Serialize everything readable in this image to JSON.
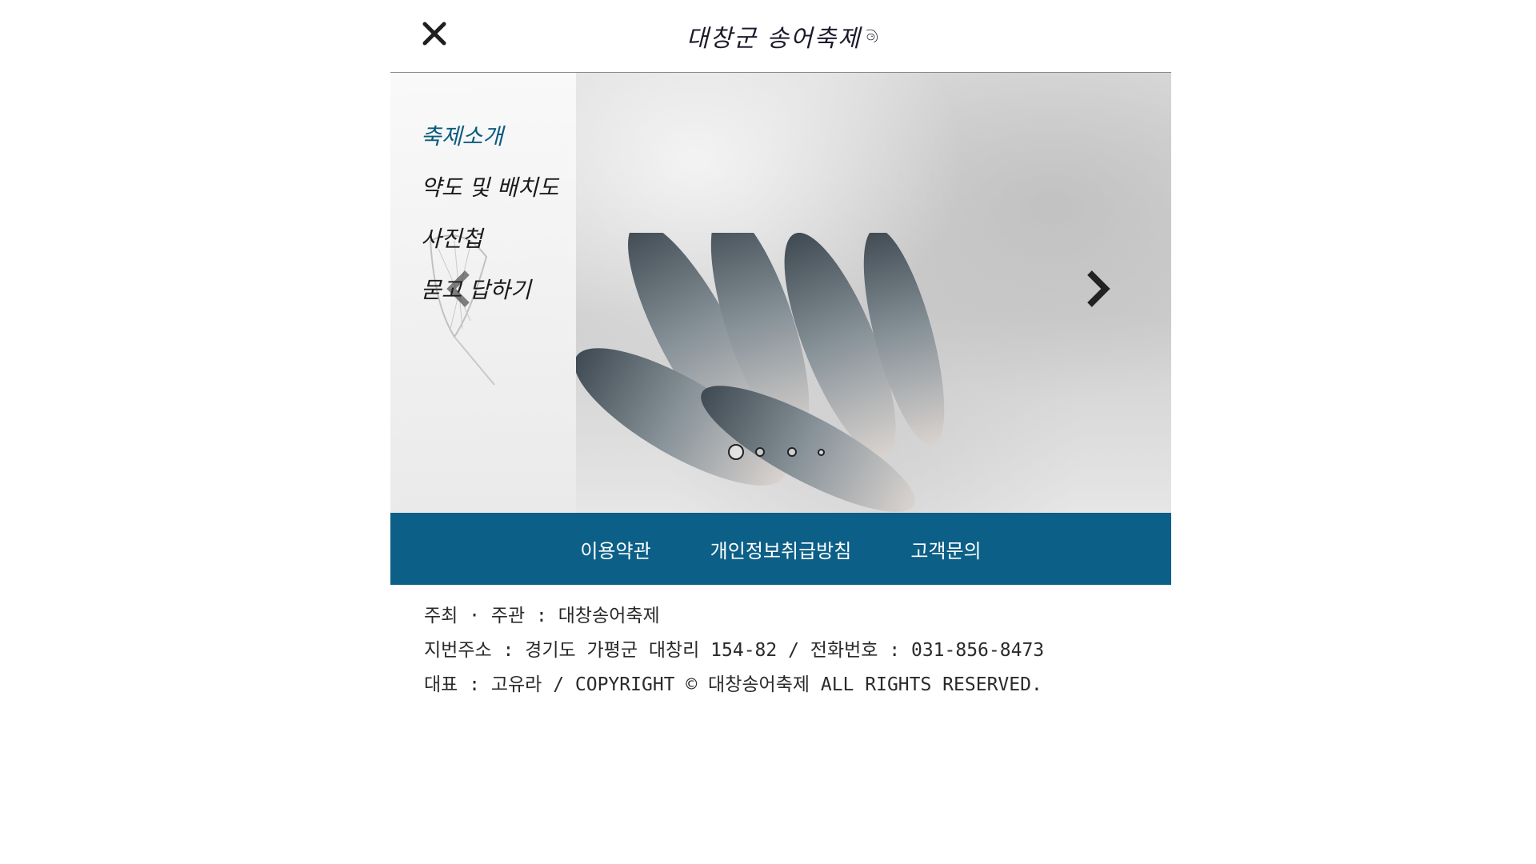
{
  "header": {
    "logo_text": "대창군 송어축제",
    "close_label": "✕"
  },
  "hero": {
    "menu": [
      {
        "label": "축제소개",
        "active": true
      },
      {
        "label": "약도 및 배치도",
        "active": false
      },
      {
        "label": "사진첩",
        "active": false
      },
      {
        "label": "묻고 답하기",
        "active": false
      }
    ],
    "slide_count": 4,
    "active_slide": 1
  },
  "footer_nav": {
    "links": [
      "이용약관",
      "개인정보취급방침",
      "고객문의"
    ]
  },
  "footer_info": {
    "lines": [
      "주최 · 주관 : 대창송어축제",
      "지번주소 : 경기도 가평군 대창리 154-82  / 전화번호 : 031-856-8473",
      "대표 : 고유라 / COPYRIGHT © 대창송어축제 ALL RIGHTS RESERVED."
    ]
  },
  "colors": {
    "accent": "#0c5f87",
    "active_menu": "#0c5b7e",
    "text": "#2a2a2a"
  }
}
